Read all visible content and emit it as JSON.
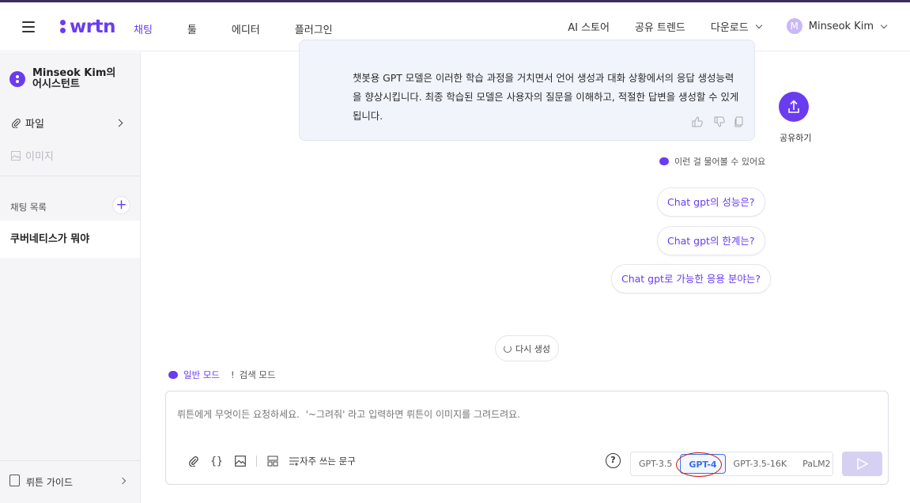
{
  "app": {
    "logo": "wrtn",
    "accent": "#6a3cf0"
  },
  "header": {
    "nav": [
      "채팅",
      "툴",
      "에디터",
      "플러그인"
    ],
    "right_nav": {
      "store": "AI 스토어",
      "trend": "공유 트렌드",
      "download": "다운로드",
      "user_initial": "M",
      "user_name": "Minseok Kim"
    }
  },
  "sidebar": {
    "assistant": "Minseok Kim의 어시스턴트",
    "file_label": "파일",
    "image_label": "이미지",
    "chat_list_title": "채팅 목록",
    "add_label": "+",
    "chats": [
      "쿠버네티스가 뭐야"
    ],
    "guide_label": "뤼튼 가이드"
  },
  "answer": {
    "text": "챗봇용 GPT 모델은 이러한 학습 과정을 거치면서 언어 생성과 대화 상황에서의 응답 생성능력을 향상시킵니다. 최종 학습된 모델은 사용자의 질문을 이해하고, 적절한 답변을 생성할 수 있게 됩니다."
  },
  "share": {
    "label": "공유하기"
  },
  "suggestions": {
    "hint": "이런 걸 물어볼 수 있어요",
    "items": [
      "Chat gpt의 성능은?",
      "Chat gpt의 한계는?",
      "Chat gpt로 가능한 응용 분야는?"
    ]
  },
  "regenerate": "다시 생성",
  "modes": {
    "normal": "일반 모드",
    "search": "검색 모드"
  },
  "input": {
    "placeholder": "뤼튼에게 무엇이든 요청하세요.  '~그려줘' 라고 입력하면 뤼튼이 이미지를 그려드려요.",
    "phrases_label": "자주 쓰는 문구",
    "help": "?"
  },
  "models": [
    "GPT-3.5",
    "GPT-4",
    "GPT-3.5-16K",
    "PaLM2"
  ],
  "selected_model": "GPT-4"
}
